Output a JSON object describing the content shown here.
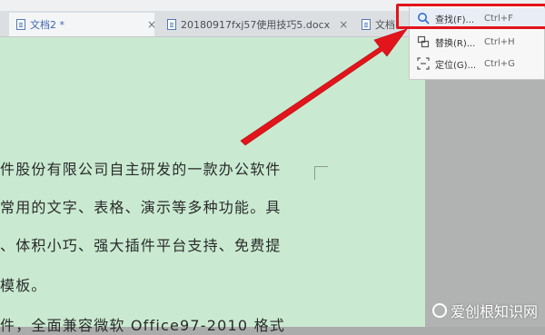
{
  "tabs": [
    {
      "label": "文档2 *",
      "close": "×",
      "active": true
    },
    {
      "label": "20180917fxj57使用技巧5.docx",
      "close": "×",
      "active": false
    },
    {
      "label": "文档",
      "close": "",
      "active": false
    }
  ],
  "context_menu": {
    "items": [
      {
        "label": "查找(F)...",
        "shortcut": "Ctrl+F",
        "icon": "search-icon"
      },
      {
        "label": "替换(R)...",
        "shortcut": "Ctrl+H",
        "icon": "replace-icon"
      },
      {
        "label": "定位(G)...",
        "shortcut": "Ctrl+G",
        "icon": "goto-icon"
      }
    ]
  },
  "document": {
    "lines": [
      "件股份有限公司自主研发的一款办公软件",
      "常用的文字、表格、演示等多种功能。具",
      "、体积小巧、强大插件平台支持、免费提",
      "模板。",
      "件，全面兼容微软 Office97-2010 格式"
    ]
  },
  "annotation": {
    "highlight_color": "#e2141c",
    "arrow_color": "#e2141c"
  },
  "watermark": {
    "text": "爱创根知识网"
  }
}
